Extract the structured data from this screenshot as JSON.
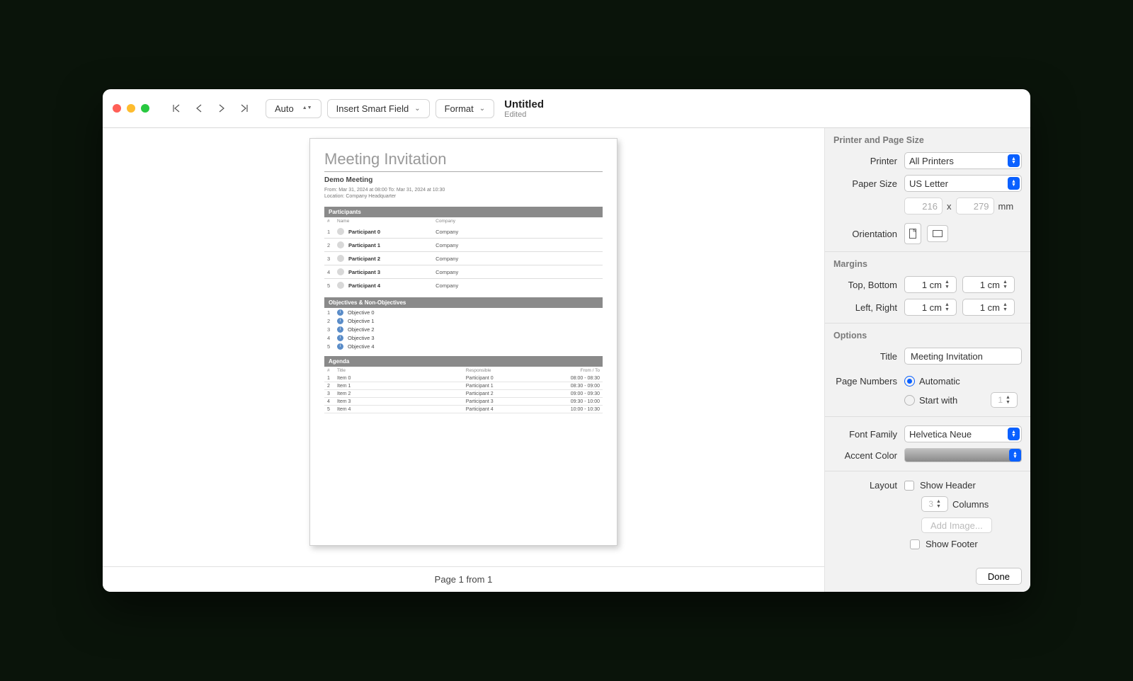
{
  "toolbar": {
    "zoom": "Auto",
    "insert": "Insert Smart Field",
    "format": "Format",
    "title": "Untitled",
    "status": "Edited"
  },
  "footer": {
    "page_counter": "Page 1 from 1"
  },
  "preview": {
    "title": "Meeting Invitation",
    "subtitle": "Demo Meeting",
    "metaLine1": "From: Mar 31, 2024 at 08:00 To: Mar 31, 2024 at 10:30",
    "metaLine2": "Location:  Company Headquarter",
    "sections": {
      "participants": "Participants",
      "objectives": "Objectives & Non-Objectives",
      "agenda": "Agenda"
    },
    "participantsHeaders": {
      "num": "#",
      "name": "Name",
      "company": "Company"
    },
    "participants": [
      {
        "n": "1",
        "name": "Participant 0",
        "company": "Company"
      },
      {
        "n": "2",
        "name": "Participant 1",
        "company": "Company"
      },
      {
        "n": "3",
        "name": "Participant 2",
        "company": "Company"
      },
      {
        "n": "4",
        "name": "Participant 3",
        "company": "Company"
      },
      {
        "n": "5",
        "name": "Participant 4",
        "company": "Company"
      }
    ],
    "objectives": [
      {
        "n": "1",
        "text": "Objective 0"
      },
      {
        "n": "2",
        "text": "Objective 1"
      },
      {
        "n": "3",
        "text": "Objective 2"
      },
      {
        "n": "4",
        "text": "Objective 3"
      },
      {
        "n": "5",
        "text": "Objective 4"
      }
    ],
    "agendaHeaders": {
      "num": "#",
      "title": "Title",
      "responsible": "Responsible",
      "time": "From / To"
    },
    "agenda": [
      {
        "n": "1",
        "title": "Item 0",
        "responsible": "Participant 0",
        "time": "08:00 - 08:30"
      },
      {
        "n": "2",
        "title": "Item 1",
        "responsible": "Participant 1",
        "time": "08:30 - 09:00"
      },
      {
        "n": "3",
        "title": "Item 2",
        "responsible": "Participant 2",
        "time": "09:00 - 09:30"
      },
      {
        "n": "4",
        "title": "Item 3",
        "responsible": "Participant 3",
        "time": "09:30 - 10:00"
      },
      {
        "n": "5",
        "title": "Item 4",
        "responsible": "Participant 4",
        "time": "10:00 - 10:30"
      }
    ]
  },
  "sidebar": {
    "section1": "Printer and Page Size",
    "printerLabel": "Printer",
    "printerValue": "All Printers",
    "paperSizeLabel": "Paper Size",
    "paperSizeValue": "US Letter",
    "width": "216",
    "height": "279",
    "unit": "mm",
    "orientationLabel": "Orientation",
    "section2": "Margins",
    "topBottomLabel": "Top, Bottom",
    "leftRightLabel": "Left, Right",
    "marginTop": "1 cm",
    "marginBottom": "1 cm",
    "marginLeft": "1 cm",
    "marginRight": "1 cm",
    "section3": "Options",
    "titleLabel": "Title",
    "titleValue": "Meeting Invitation",
    "pageNumbersLabel": "Page Numbers",
    "automatic": "Automatic",
    "startWith": "Start with",
    "startWithVal": "1",
    "fontFamilyLabel": "Font Family",
    "fontFamilyValue": "Helvetica Neue",
    "accentLabel": "Accent Color",
    "layoutLabel": "Layout",
    "showHeader": "Show Header",
    "headerCols": "3",
    "columns": "Columns",
    "addImage": "Add Image...",
    "showFooter": "Show Footer",
    "done": "Done"
  }
}
